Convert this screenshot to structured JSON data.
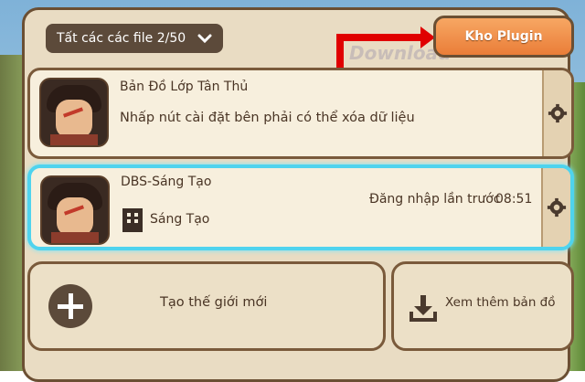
{
  "filter": {
    "label": "Tất các các file 2/50"
  },
  "plugin_button": {
    "label": "Kho Plugin"
  },
  "watermark": "Download",
  "dot_colors": [
    "#b9d9f5",
    "#f5c9d6",
    "#f8e3a8",
    "#cfe8c4",
    "#f4d1b0"
  ],
  "maps": [
    {
      "title": "Bản Đồ Lớp Tân Thủ",
      "description": "Nhấp nút cài đặt bên phải có thể xóa dữ liệu"
    },
    {
      "title": "DBS-Sáng Tạo",
      "mode": "Sáng Tạo",
      "last_login_label": "Đăng nhập lần trước",
      "last_login_time": "08:51"
    }
  ],
  "actions": {
    "create_world": "Tạo thế giới mới",
    "more_maps": "Xem thêm bản đồ"
  },
  "colors": {
    "highlight": "#4fd3ee",
    "accent": "#ea7d38",
    "arrow": "#e00000"
  }
}
